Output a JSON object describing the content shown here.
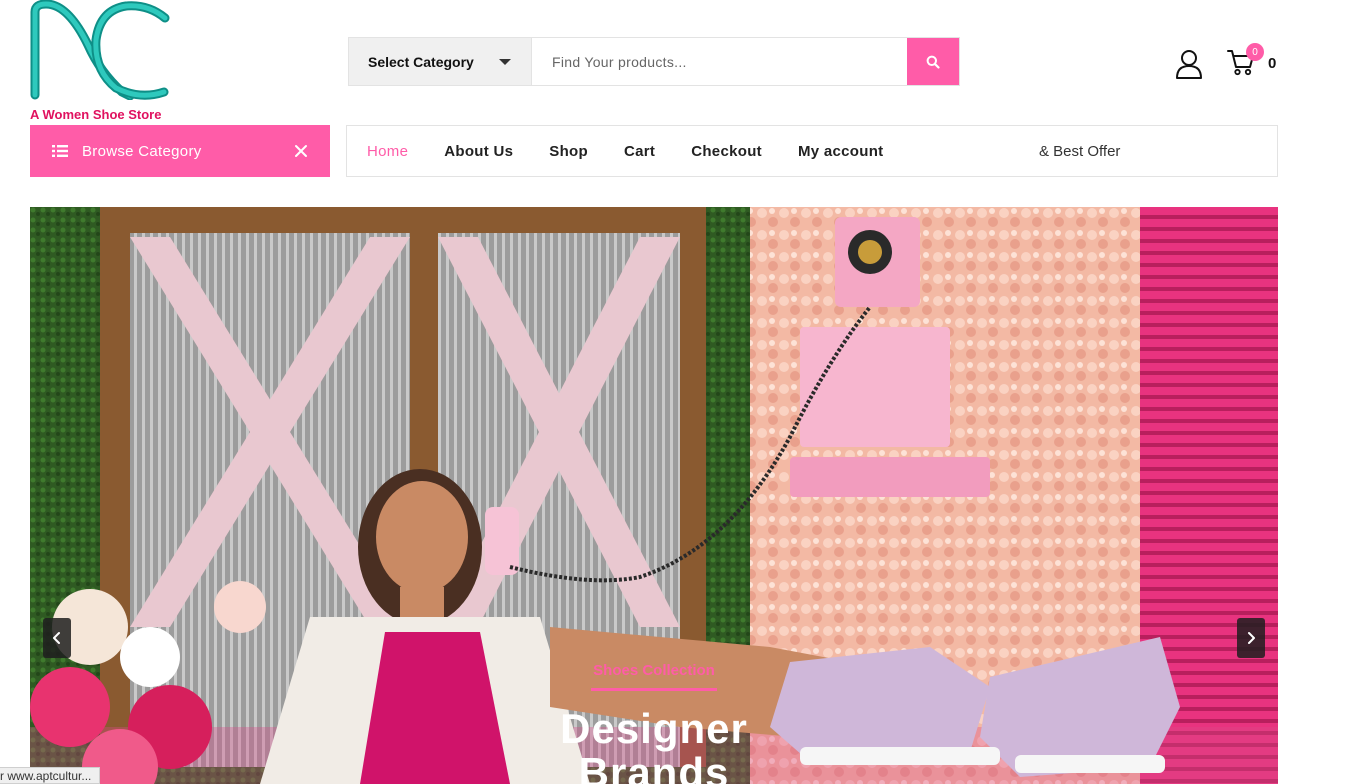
{
  "brand": {
    "tagline": "A Women Shoe Store",
    "primary_color": "#ff5ca8",
    "logo_color": "#13b1a6"
  },
  "search": {
    "category_label": "Select Category",
    "placeholder": "Find Your products..."
  },
  "cart": {
    "badge_count": "0",
    "total": "0"
  },
  "browse": {
    "label": "Browse Category"
  },
  "nav": {
    "items": [
      {
        "label": "Home"
      },
      {
        "label": "About Us"
      },
      {
        "label": "Shop"
      },
      {
        "label": "Cart"
      },
      {
        "label": "Checkout"
      },
      {
        "label": "My account"
      }
    ],
    "active_index": 0,
    "offer_text": "& Best Offer"
  },
  "hero": {
    "subtitle": "Shoes Collection",
    "title_line1": "Designer",
    "title_line2": "Brands"
  },
  "status_bar": {
    "text": "r www.aptcultur..."
  },
  "icons": {
    "search": "search-icon",
    "user": "user-icon",
    "cart": "cart-icon",
    "menu": "list-icon",
    "close": "close-icon",
    "prev": "chevron-left-icon",
    "next": "chevron-right-icon"
  }
}
